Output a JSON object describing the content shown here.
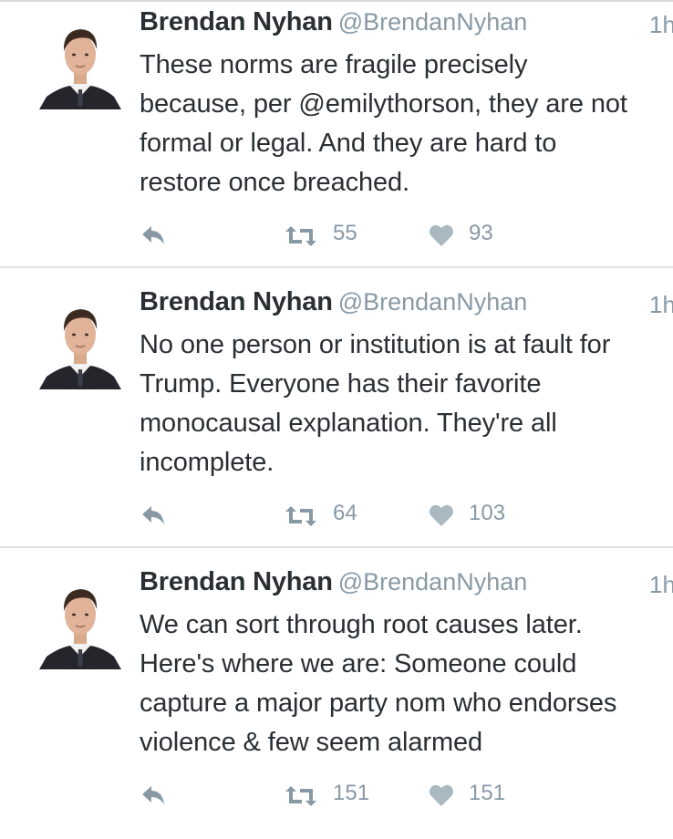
{
  "colors": {
    "name": "#292f33",
    "muted": "#8899a6",
    "divider": "#dfe3e6",
    "background": "#ffffff"
  },
  "tweets": [
    {
      "name": "Brendan Nyhan",
      "handle": "@BrendanNyhan",
      "time": "1h",
      "text": "These norms are fragile precisely\nbecause, per @emilythorson, they are not\nformal or legal. And they are hard to\nrestore once breached.",
      "retweets": "55",
      "likes": "93",
      "icons": {
        "reply": "reply-arrow",
        "retweet": "retweet-arrows",
        "like": "heart"
      }
    },
    {
      "name": "Brendan Nyhan",
      "handle": "@BrendanNyhan",
      "time": "1h",
      "text": "No one person or institution is at fault for\nTrump. Everyone has their favorite\nmonocausal explanation. They're all\nincomplete.",
      "retweets": "64",
      "likes": "103",
      "icons": {
        "reply": "reply-arrow",
        "retweet": "retweet-arrows",
        "like": "heart"
      }
    },
    {
      "name": "Brendan Nyhan",
      "handle": "@BrendanNyhan",
      "time": "1h",
      "text": "We can sort through root causes later.\nHere's where we are: Someone could\ncapture a major party nom who endorses\nviolence & few seem alarmed",
      "retweets": "151",
      "likes": "151",
      "icons": {
        "reply": "reply-arrow",
        "retweet": "retweet-arrows",
        "like": "heart"
      }
    }
  ]
}
